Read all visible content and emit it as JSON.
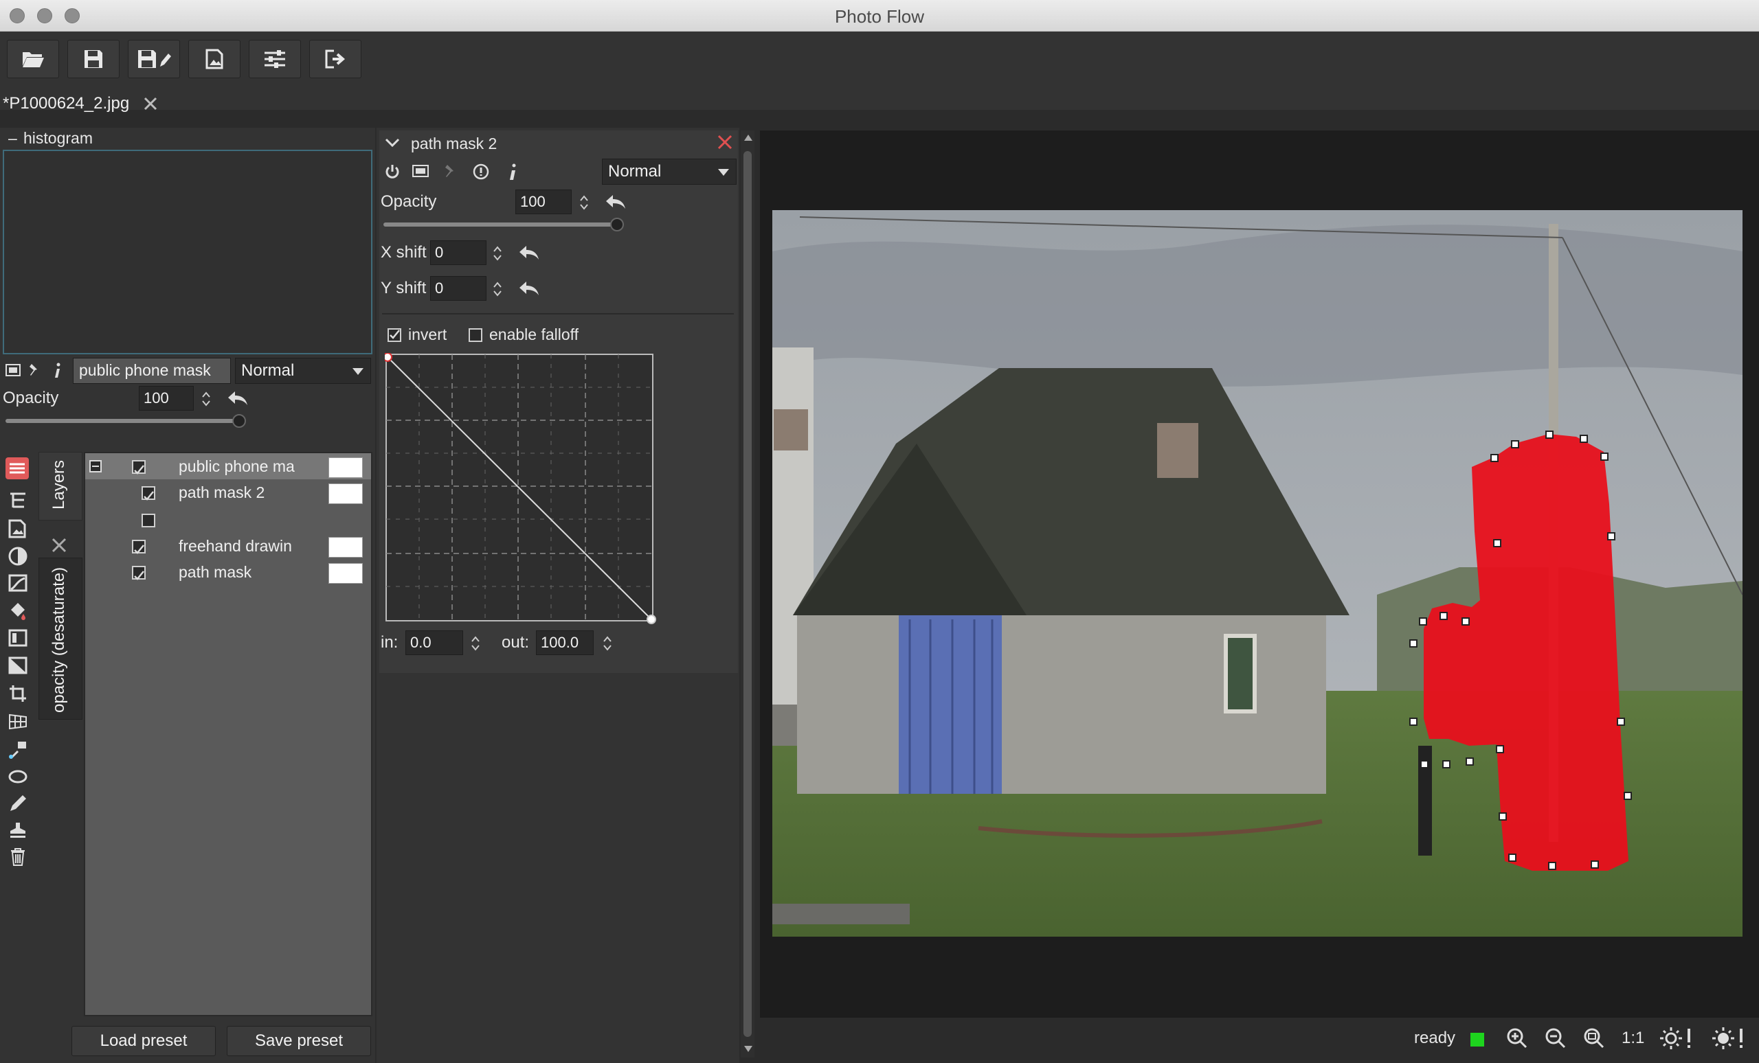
{
  "window": {
    "title": "Photo Flow"
  },
  "document_tab": {
    "filename": "*P1000624_2.jpg"
  },
  "histogram": {
    "toggle": "–",
    "label": "histogram"
  },
  "layer_props": {
    "name_value": "public phone mask",
    "blend_mode": "Normal",
    "opacity_label": "Opacity",
    "opacity_value": "100"
  },
  "side_tabs": {
    "layers": "Layers",
    "opacity": "opacity (desaturate)"
  },
  "layers": [
    {
      "name": "public phone ma",
      "checked": true
    },
    {
      "name": "path mask 2",
      "checked": true
    },
    {
      "name": "",
      "checked": false
    },
    {
      "name": "freehand drawin",
      "checked": true
    },
    {
      "name": "path mask",
      "checked": true
    }
  ],
  "presets": {
    "load": "Load preset",
    "save": "Save preset"
  },
  "tool_panel": {
    "title": "path mask 2",
    "blend_mode": "Normal",
    "opacity_label": "Opacity",
    "opacity_value": "100",
    "xshift_label": "X shift",
    "xshift_value": "0",
    "yshift_label": "Y shift",
    "yshift_value": "0",
    "invert_label": "invert",
    "falloff_label": "enable falloff",
    "in_label": "in:",
    "in_value": "0.0",
    "out_label": "out:",
    "out_value": "100.0"
  },
  "status": {
    "text": "ready",
    "zoom_1to1": "1:1",
    "indicator_color": "#1ed41e"
  },
  "colors": {
    "mask": "#e8101c",
    "background": "#2b2b2b",
    "panel": "#3a3a3a"
  }
}
